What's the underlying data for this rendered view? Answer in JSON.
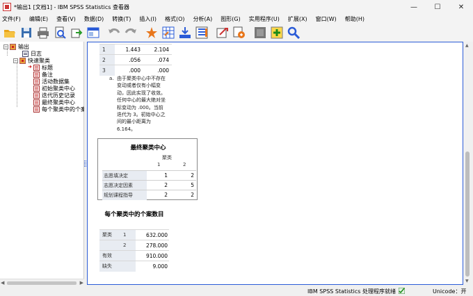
{
  "window": {
    "title": "*输出1 [文档1] - IBM SPSS Statistics 查看器",
    "minimize": "—",
    "maximize": "☐",
    "close": "✕"
  },
  "menu": [
    "文件(F)",
    "编辑(E)",
    "查看(V)",
    "数据(D)",
    "转换(T)",
    "插入(I)",
    "格式(O)",
    "分析(A)",
    "图形(G)",
    "实用程序(U)",
    "扩展(X)",
    "窗口(W)",
    "帮助(H)"
  ],
  "toolbar": [
    "open-icon",
    "save-icon",
    "print-icon",
    "print-preview-icon",
    "export-icon",
    "recall-dialog-icon",
    "undo-icon",
    "redo-icon",
    "goto-data-icon",
    "goto-case-icon",
    "goto-variable-icon",
    "variables-icon",
    "designate-window-icon",
    "insert-output-icon",
    "show-all-icon",
    "hide-icon",
    "insert-item-icon",
    "search-icon"
  ],
  "tree": {
    "root": "输出",
    "log": "日志",
    "group": "快速聚类",
    "items": [
      "标题",
      "备注",
      "活动数据集",
      "初始聚类中心",
      "迭代历史记录",
      "最终聚类中心",
      "每个聚类中的个案"
    ]
  },
  "iteration": {
    "rows": [
      {
        "label": "1",
        "v1": "1.443",
        "v2": "2.104"
      },
      {
        "label": "2",
        "v1": ".056",
        "v2": ".074"
      },
      {
        "label": "3",
        "v1": ".000",
        "v2": ".000"
      }
    ],
    "footnote_marker": "a.",
    "footnote_lines": [
      "由于聚类中心中不存在",
      "变动或者仅有小幅变",
      "动，因此实现了收敛。",
      "任何中心的最大绝对坐",
      "标变动为 .000。当前",
      "迭代为 3。初始中心之",
      "间的最小距离为",
      "6.164。"
    ]
  },
  "final_centers": {
    "title": "最终聚类中心",
    "cluster_header": "聚类",
    "col1": "1",
    "col2": "2",
    "rows": [
      {
        "label": "志愿填决定",
        "v1": "1",
        "v2": "2"
      },
      {
        "label": "志愿决定因素",
        "v1": "2",
        "v2": "5"
      },
      {
        "label": "规划课程指导",
        "v1": "2",
        "v2": "2"
      }
    ]
  },
  "case_counts": {
    "title": "每个聚类中的个案数目",
    "rows": [
      {
        "l1": "聚类",
        "l2": "1",
        "v": "632.000"
      },
      {
        "l1": "",
        "l2": "2",
        "v": "278.000"
      },
      {
        "l1": "有效",
        "l2": "",
        "v": "910.000"
      },
      {
        "l1": "缺失",
        "l2": "",
        "v": "9.000"
      }
    ]
  },
  "status": {
    "processor": "IBM SPSS Statistics 处理程序就绪",
    "unicode": "Unicode：开"
  }
}
